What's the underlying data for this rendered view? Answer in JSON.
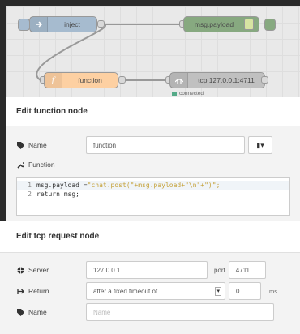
{
  "flow": {
    "nodes": {
      "inject": "inject",
      "debug": "msg.payload",
      "function": "function",
      "tcp": "tcp:127.0.0.1:4711"
    },
    "tcp_status": "connected"
  },
  "function_dialog": {
    "title": "Edit function node",
    "name_label": "Name",
    "name_value": "function",
    "function_label": "Function",
    "code": {
      "line_numbers": [
        "1",
        "2"
      ],
      "line1_prefix": "msg.payload = ",
      "line1_string": "\"chat.post(\"+msg.payload+\"\\n\"+\")\";",
      "line2": "return msg;"
    }
  },
  "tcp_dialog": {
    "title": "Edit tcp request node",
    "server_label": "Server",
    "server_value": "127.0.0.1",
    "port_label": "port",
    "port_value": "4711",
    "return_label": "Return",
    "return_value": "after a fixed timeout of",
    "timeout_value": "0",
    "timeout_unit": "ms",
    "name_label": "Name",
    "name_placeholder": "Name"
  },
  "colors": {
    "inject": "#a6bbcf",
    "debug": "#87a980",
    "function": "#fdd0a2",
    "tcp": "#c0c0c0",
    "status_ok": "#55aa88"
  },
  "icons": {
    "inject": "arrow-right-icon",
    "function": "function-icon",
    "tcp": "bridge-icon",
    "debug": "list-icon",
    "name": "tag-icon",
    "function_label": "wrench-icon",
    "server": "globe-icon",
    "return": "sign-out-icon",
    "book": "book-icon"
  }
}
